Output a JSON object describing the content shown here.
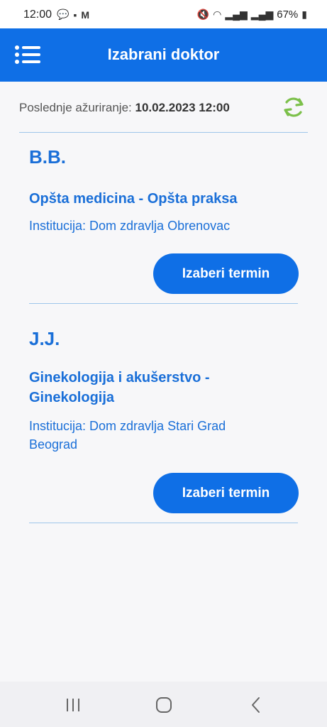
{
  "status_bar": {
    "time": "12:00",
    "battery": "67%"
  },
  "header": {
    "title": "Izabrani doktor"
  },
  "update": {
    "label": "Poslednje ažuriranje:",
    "value": "10.02.2023 12:00"
  },
  "doctors": [
    {
      "name": "B.B.",
      "specialty": "Opšta medicina - Opšta praksa",
      "institution": "Institucija: Dom zdravlja Obrenovac",
      "button_label": "Izaberi termin"
    },
    {
      "name": "J.J.",
      "specialty_line1": "Ginekologija i akušerstvo -",
      "specialty_line2": "Ginekologija",
      "institution_line1": "Institucija: Dom zdravlja Stari Grad",
      "institution_line2": "Beograd",
      "button_label": "Izaberi termin"
    }
  ],
  "colors": {
    "primary": "#0f6fe6",
    "text_blue": "#1a6fd8",
    "refresh_green": "#7cc04a",
    "divider": "#9fc6ea"
  }
}
